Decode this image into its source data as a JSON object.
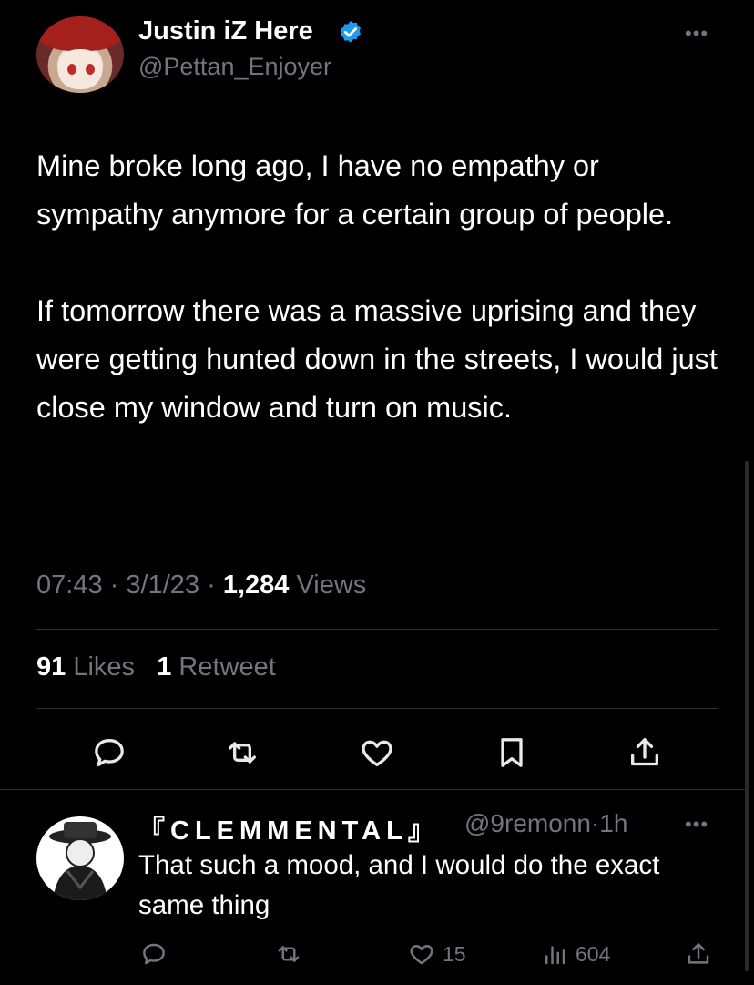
{
  "tweet": {
    "author_name": "Justin iZ Here",
    "author_handle": "@Pettan_Enjoyer",
    "more_label": "•••",
    "paragraph_1": "Mine broke long ago, I have no empathy or sympathy anymore for a certain group of people.",
    "paragraph_2": "If tomorrow there was a massive uprising and they were getting hunted down in the streets, I would just close my window and turn on music.",
    "time": "07:43",
    "date": "3/1/23",
    "separator": "·",
    "views_count": "1,284",
    "views_label": "Views",
    "likes_count": "91",
    "likes_label": "Likes",
    "retweets_count": "1",
    "retweets_label": "Retweet"
  },
  "reply": {
    "author_name": "『CLEMMENTAL』",
    "author_handle": "@9remonn",
    "separator": "·",
    "time": "1h",
    "more_label": "•••",
    "text": "That such a mood, and I would do the exact same thing",
    "likes_count": "15",
    "views_count": "604"
  },
  "icons": {
    "verified": "verified-badge-icon",
    "reply": "reply-icon",
    "retweet": "retweet-icon",
    "like": "heart-icon",
    "bookmark": "bookmark-icon",
    "share": "share-icon",
    "views": "analytics-icon"
  },
  "colors": {
    "background": "#000000",
    "text": "#ffffff",
    "secondary": "#71767b",
    "divider": "#2f3336",
    "verified": "#1d9bf0"
  }
}
